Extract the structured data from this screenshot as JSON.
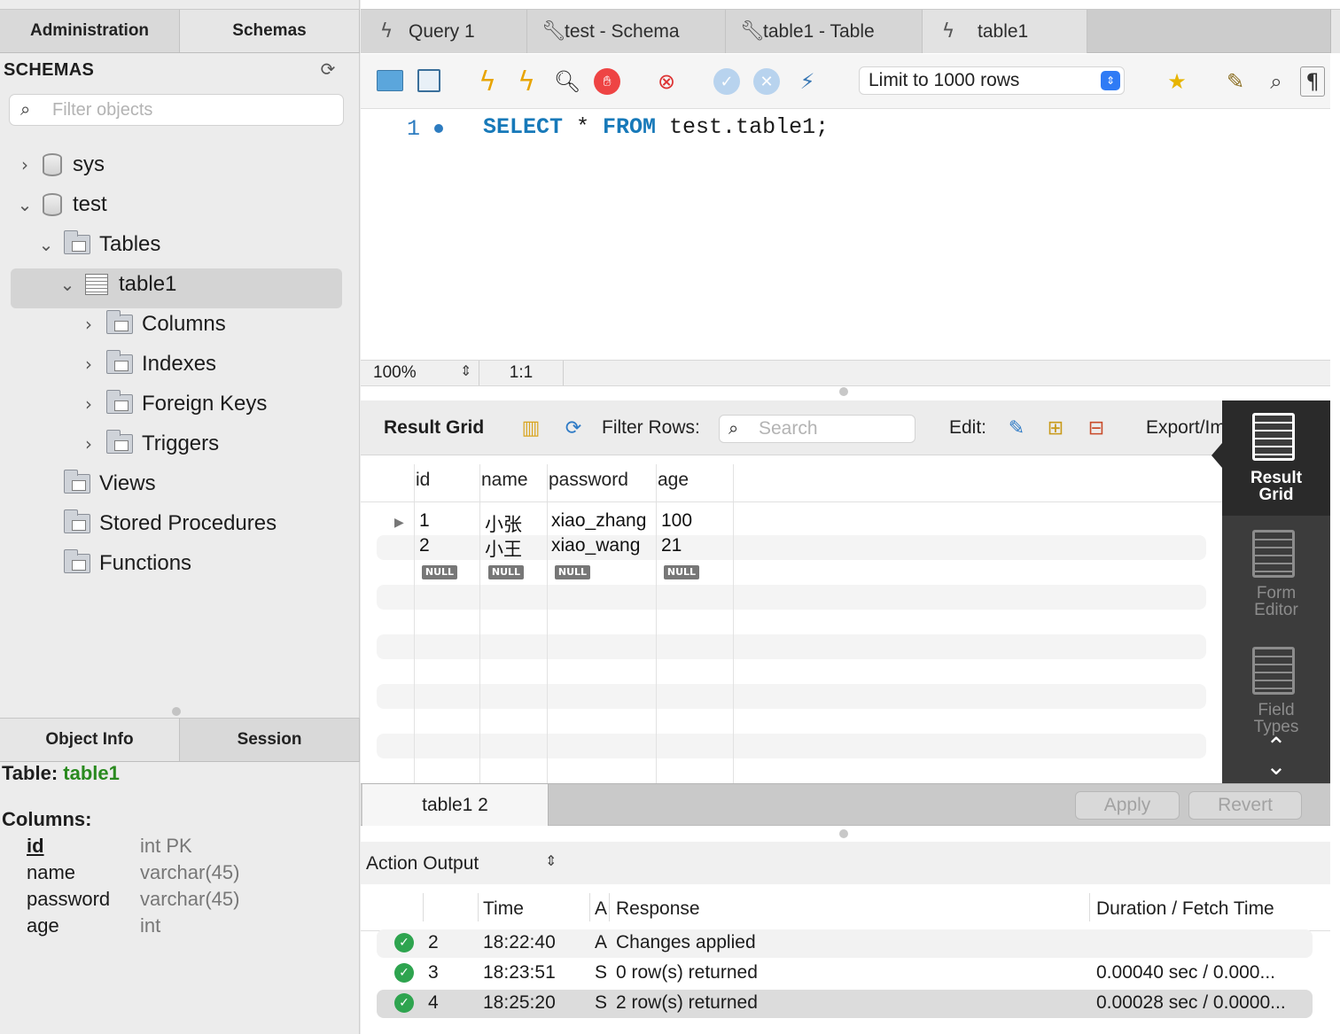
{
  "left": {
    "tabs": [
      "Administration",
      "Schemas"
    ],
    "schemas_title": "SCHEMAS",
    "filter_placeholder": "Filter objects",
    "tree": {
      "sys": "sys",
      "test": "test",
      "tables": "Tables",
      "table1": "table1",
      "columns": "Columns",
      "indexes": "Indexes",
      "foreign_keys": "Foreign Keys",
      "triggers": "Triggers",
      "views": "Views",
      "stored_procedures": "Stored Procedures",
      "functions": "Functions"
    },
    "bottom_tabs": [
      "Object Info",
      "Session"
    ],
    "info": {
      "table_label": "Table:",
      "table_name": "table1",
      "columns_label": "Columns:",
      "columns": [
        {
          "name": "id",
          "type": "int PK"
        },
        {
          "name": "name",
          "type": "varchar(45)"
        },
        {
          "name": "password",
          "type": "varchar(45)"
        },
        {
          "name": "age",
          "type": "int"
        }
      ]
    }
  },
  "tabs": [
    {
      "label": "Query 1",
      "icon": "lightning-icon"
    },
    {
      "label": "test - Schema",
      "icon": "wrench-icon"
    },
    {
      "label": "table1 - Table",
      "icon": "wrench-icon"
    },
    {
      "label": "table1",
      "icon": "lightning-icon"
    }
  ],
  "toolbar": {
    "limit_label": "Limit to 1000 rows"
  },
  "editor": {
    "line_number": "1",
    "sql_kw1": "SELECT",
    "sql_star": " * ",
    "sql_kw2": "FROM",
    "sql_rest": " test.table1;"
  },
  "status": {
    "zoom": "100%",
    "position": "1:1"
  },
  "results": {
    "title": "Result Grid",
    "filter_label": "Filter Rows:",
    "search_placeholder": "Search",
    "edit_label": "Edit:",
    "export_label": "Export/Im",
    "headers": [
      "id",
      "name",
      "password",
      "age"
    ],
    "rows": [
      [
        "1",
        "小张",
        "xiao_zhang",
        "100"
      ],
      [
        "2",
        "小王",
        "xiao_wang",
        "21"
      ]
    ],
    "null_label": "NULL",
    "footer_tab": "table1 2",
    "apply": "Apply",
    "revert": "Revert"
  },
  "side_panel": {
    "result_grid": [
      "Result",
      "Grid"
    ],
    "form_editor": [
      "Form",
      "Editor"
    ],
    "field_types": [
      "Field",
      "Types"
    ]
  },
  "output": {
    "title": "Action Output",
    "headers": {
      "time": "Time",
      "action": "A",
      "response": "Response",
      "duration": "Duration / Fetch Time"
    },
    "rows": [
      {
        "num": "2",
        "time": "18:22:40",
        "action": "A",
        "response": "Changes applied",
        "duration": ""
      },
      {
        "num": "3",
        "time": "18:23:51",
        "action": "S",
        "response": "0 row(s) returned",
        "duration": "0.00040 sec / 0.000..."
      },
      {
        "num": "4",
        "time": "18:25:20",
        "action": "S",
        "response": "2 row(s) returned",
        "duration": "0.00028 sec / 0.0000..."
      }
    ]
  }
}
